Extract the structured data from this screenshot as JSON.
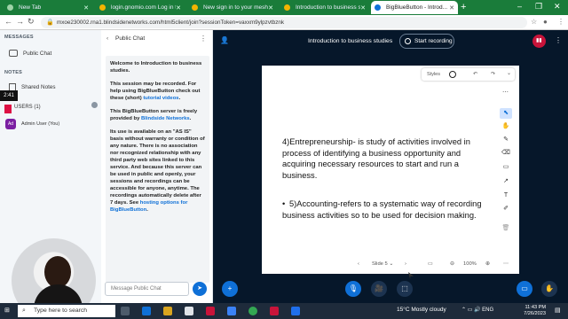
{
  "browser": {
    "tabs": [
      {
        "label": "New Tab",
        "active": false
      },
      {
        "label": "login.gnomio.com Log in to",
        "active": false
      },
      {
        "label": "New sign in to your meshacl",
        "active": false
      },
      {
        "label": "Introduction to business stu",
        "active": false
      },
      {
        "label": "BigBlueButton - Introd...",
        "active": true
      }
    ],
    "url": "mxoe230002.rna1.blindsidenetworks.com/html5client/join?sessionToken=vaxxm9ylpzvtbznk"
  },
  "leftnav": {
    "messages_heading": "MESSAGES",
    "public_chat": "Public Chat",
    "notes_heading": "NOTES",
    "shared_notes": "Shared Notes",
    "time_badge": "2:41",
    "users_label": "USERS (1)",
    "user_avatar": "Ad",
    "user_name": "Admin User (You)"
  },
  "chat": {
    "header": "Public Chat",
    "message": {
      "p1": "Welcome to Introduction to business studies.",
      "p2_a": "This session may be recorded. For help using BigBlueButton check out these (short) ",
      "p2_link": "tutorial videos",
      "p2_b": ".",
      "p3_a": "This BigBlueButton server is freely provided by ",
      "p3_link": "Blindside Networks",
      "p3_b": ".",
      "p4": "Its use is available on an \"AS IS\" basis without warranty or condition of any nature. There is no association nor recognized relationship with any third party web sites linked to this service. And because this server can be used in public and openly, your sessions and recordings can be accessible for anyone, anytime. The recordings automatically delete after 7 days. See ",
      "p4_link": "hosting options for BigBlueButton",
      "p4_b": "."
    },
    "input_placeholder": "Message Public Chat"
  },
  "stage": {
    "meeting_title": "Introduction to business studies",
    "record_label": "Start recording",
    "styles_label": "Styles",
    "slide_paragraph_1": "4)Entrepreneurship- is study of activities involved in process of identifying a business opportunity and acquiring necessary resources to start and run a business.",
    "slide_paragraph_2": "5)Accounting-refers to a systematic way of recording business activities so to be used for decision making.",
    "slide_label": "Slide 5",
    "zoom_level": "100%"
  },
  "taskbar": {
    "search_placeholder": "Type here to search",
    "weather": "15°C  Mostly cloudy",
    "time": "11:43 PM",
    "date": "7/26/2023"
  },
  "colors": {
    "tabstrip": "#1a7c3a",
    "stage_bg": "#06172a",
    "accent_blue": "#0f70d7",
    "record_red": "#c8143a"
  }
}
